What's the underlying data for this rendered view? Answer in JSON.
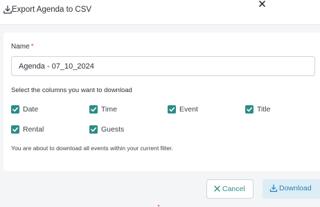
{
  "dialog": {
    "title": "Export Agenda to CSV"
  },
  "form": {
    "name_label": "Name",
    "name_required_mark": "*",
    "name_value": "Agenda - 07_10_2024",
    "columns_label": "Select the columns you want to download",
    "columns": [
      {
        "label": "Date",
        "checked": true
      },
      {
        "label": "Time",
        "checked": true
      },
      {
        "label": "Event",
        "checked": true
      },
      {
        "label": "Title",
        "checked": true
      },
      {
        "label": "Rental",
        "checked": true
      },
      {
        "label": "Guests",
        "checked": true
      }
    ],
    "info_text": "You are about to download all events within your current filter."
  },
  "footer": {
    "cancel_label": "Cancel",
    "download_label": "Download"
  },
  "colors": {
    "accent_teal": "#2c8c88",
    "download_bg": "#dcedf6",
    "download_text": "#2c7eb5",
    "required": "#e0453a"
  },
  "icons": {
    "header": "download-icon",
    "close": "close-icon",
    "cancel": "x-icon",
    "download": "download-icon",
    "checkbox": "checkmark-icon"
  }
}
